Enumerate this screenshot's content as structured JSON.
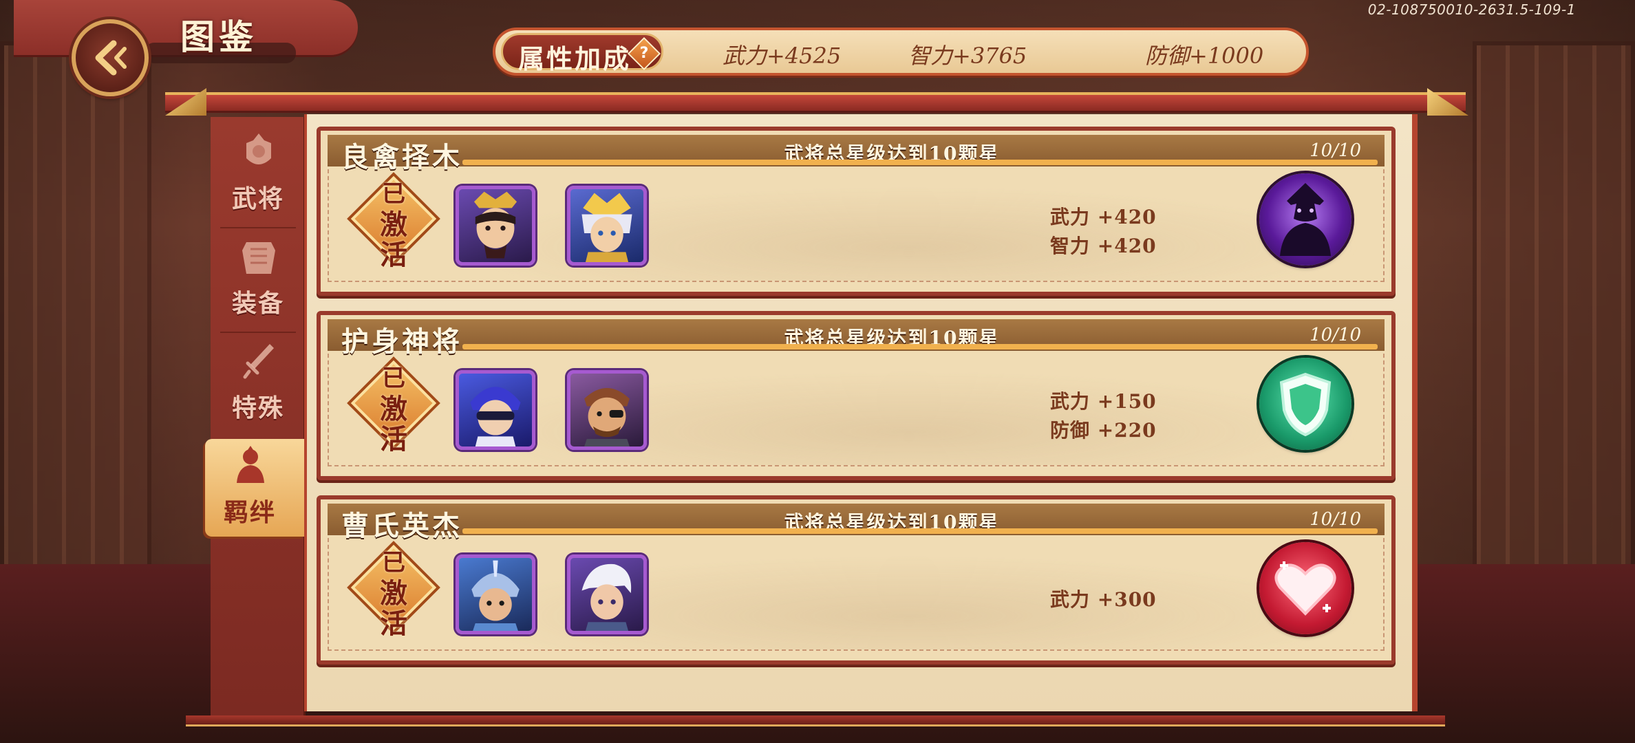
{
  "build_id": "02-108750010-2631.5-109-1",
  "header": {
    "title": "图鉴"
  },
  "attributes": {
    "label": "属性加成",
    "help": "?",
    "items": [
      "武力+4525",
      "智力+3765",
      "防御+1000"
    ]
  },
  "tabs": [
    {
      "label": "武将",
      "icon": "helmet-icon",
      "active": false
    },
    {
      "label": "装备",
      "icon": "armor-icon",
      "active": false
    },
    {
      "label": "特殊",
      "icon": "sword-icon",
      "active": false
    },
    {
      "label": "羁绊",
      "icon": "warrior-icon",
      "active": true
    }
  ],
  "cards": [
    {
      "name": "良禽择木",
      "condition": "武将总星级达到10颗星",
      "progress": "10/10",
      "status": [
        "已",
        "激",
        "活"
      ],
      "heroes": [
        "hero-portrait-1",
        "hero-portrait-2"
      ],
      "bonuses": [
        "武力 +420",
        "智力 +420"
      ],
      "skill": "shadow-figure-icon"
    },
    {
      "name": "护身神将",
      "condition": "武将总星级达到10颗星",
      "progress": "10/10",
      "status": [
        "已",
        "激",
        "活"
      ],
      "heroes": [
        "hero-portrait-3",
        "hero-portrait-4"
      ],
      "bonuses": [
        "武力 +150",
        "防御 +220"
      ],
      "skill": "shield-icon"
    },
    {
      "name": "曹氏英杰",
      "condition": "武将总星级达到10颗星",
      "progress": "10/10",
      "status": [
        "已",
        "激",
        "活"
      ],
      "heroes": [
        "hero-portrait-5",
        "hero-portrait-6"
      ],
      "bonuses": [
        "武力 +300"
      ],
      "skill": "heart-icon"
    }
  ],
  "colors": {
    "accent_red": "#9a3a2c",
    "gold": "#e8b45c",
    "paper": "#f0dcb4",
    "text_brown": "#7a3a1e",
    "portrait_border": "#a65ad0"
  }
}
